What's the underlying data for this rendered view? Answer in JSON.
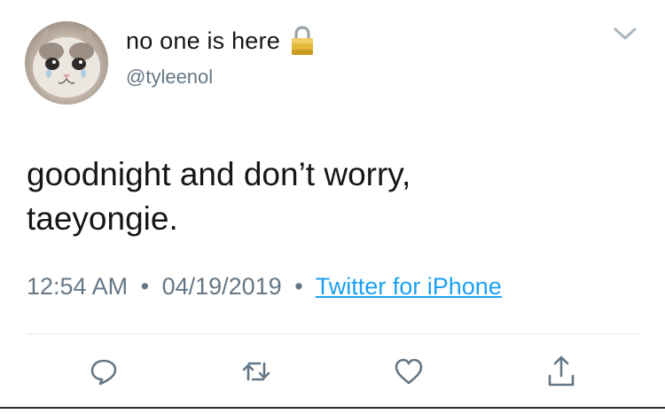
{
  "user": {
    "display_name": "no one is here",
    "handle": "@tyleenol",
    "lock_icon": "lock-icon",
    "avatar": "crying-cat-avatar"
  },
  "tweet": {
    "text_line1": "goodnight and don’t worry,",
    "text_line2": "taeyongie."
  },
  "meta": {
    "time": "12:54 AM",
    "date": "04/19/2019",
    "separator": "•",
    "source": "Twitter for iPhone"
  },
  "actions": {
    "reply_icon": "reply-icon",
    "retweet_icon": "retweet-icon",
    "like_icon": "heart-icon",
    "share_icon": "share-icon"
  },
  "colors": {
    "text": "#14171a",
    "secondary": "#657786",
    "link": "#1da1f2",
    "divider": "#e1e8ed"
  }
}
